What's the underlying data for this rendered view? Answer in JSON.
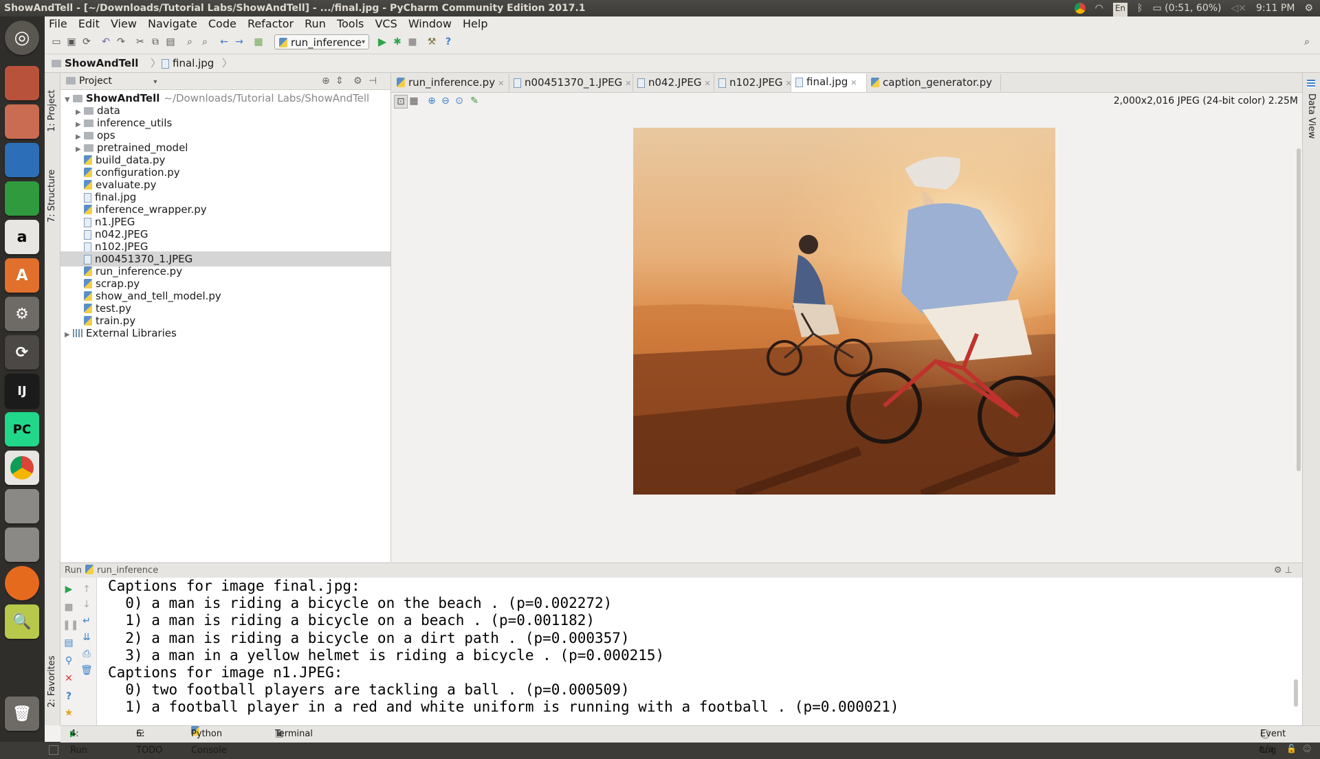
{
  "os": {
    "window_title": "ShowAndTell - [~/Downloads/Tutorial Labs/ShowAndTell] - .../final.jpg - PyCharm Community Edition 2017.1",
    "battery": "(0:51, 60%)",
    "keyboard_layout": "En",
    "clock": "9:11 PM"
  },
  "menu": [
    "File",
    "Edit",
    "View",
    "Navigate",
    "Code",
    "Refactor",
    "Run",
    "Tools",
    "VCS",
    "Window",
    "Help"
  ],
  "toolbar": {
    "run_config": "run_inference"
  },
  "breadcrumb": [
    "ShowAndTell",
    "final.jpg"
  ],
  "project_panel": {
    "title": "Project",
    "stripe_labels": [
      "1: Project",
      "7: Structure",
      "2: Favorites"
    ],
    "root": {
      "name": "ShowAndTell",
      "path": "~/Downloads/Tutorial Labs/ShowAndTell"
    },
    "items": [
      {
        "name": "data",
        "type": "folder"
      },
      {
        "name": "inference_utils",
        "type": "folder"
      },
      {
        "name": "ops",
        "type": "folder"
      },
      {
        "name": "pretrained_model",
        "type": "folder"
      },
      {
        "name": "build_data.py",
        "type": "py"
      },
      {
        "name": "configuration.py",
        "type": "py"
      },
      {
        "name": "evaluate.py",
        "type": "py"
      },
      {
        "name": "final.jpg",
        "type": "img"
      },
      {
        "name": "inference_wrapper.py",
        "type": "py"
      },
      {
        "name": "n1.JPEG",
        "type": "img"
      },
      {
        "name": "n042.JPEG",
        "type": "img"
      },
      {
        "name": "n102.JPEG",
        "type": "img"
      },
      {
        "name": "n00451370_1.JPEG",
        "type": "img",
        "selected": true
      },
      {
        "name": "run_inference.py",
        "type": "py"
      },
      {
        "name": "scrap.py",
        "type": "py"
      },
      {
        "name": "show_and_tell_model.py",
        "type": "py"
      },
      {
        "name": "test.py",
        "type": "py"
      },
      {
        "name": "train.py",
        "type": "py"
      }
    ],
    "external": "External Libraries"
  },
  "editor": {
    "tabs": [
      {
        "label": "run_inference.py",
        "type": "py"
      },
      {
        "label": "n00451370_1.JPEG",
        "type": "img"
      },
      {
        "label": "n042.JPEG",
        "type": "img"
      },
      {
        "label": "n102.JPEG",
        "type": "img"
      },
      {
        "label": "final.jpg",
        "type": "img",
        "active": true
      },
      {
        "label": "caption_generator.py",
        "type": "py"
      }
    ],
    "image_info": "2,000x2,016 JPEG (24-bit color) 2.25M",
    "right_stripe": "Data View"
  },
  "run_panel": {
    "label": "Run",
    "config": "run_inference",
    "lines": [
      "Captions for image final.jpg:",
      "  0) a man is riding a bicycle on the beach . (p=0.002272)",
      "  1) a man is riding a bicycle on a beach . (p=0.001182)",
      "  2) a man is riding a bicycle on a dirt path . (p=0.000357)",
      "  3) a man in a yellow helmet is riding a bicycle . (p=0.000215)",
      "Captions for image n1.JPEG:",
      "  0) two football players are tackling a ball . (p=0.000509)",
      "  1) a football player in a red and white uniform is running with a football . (p=0.000021)"
    ]
  },
  "bottom_tabs": [
    "4: Run",
    "6: TODO",
    "Python Console",
    "Terminal"
  ],
  "event_log": "Event Log",
  "status": "n/a"
}
